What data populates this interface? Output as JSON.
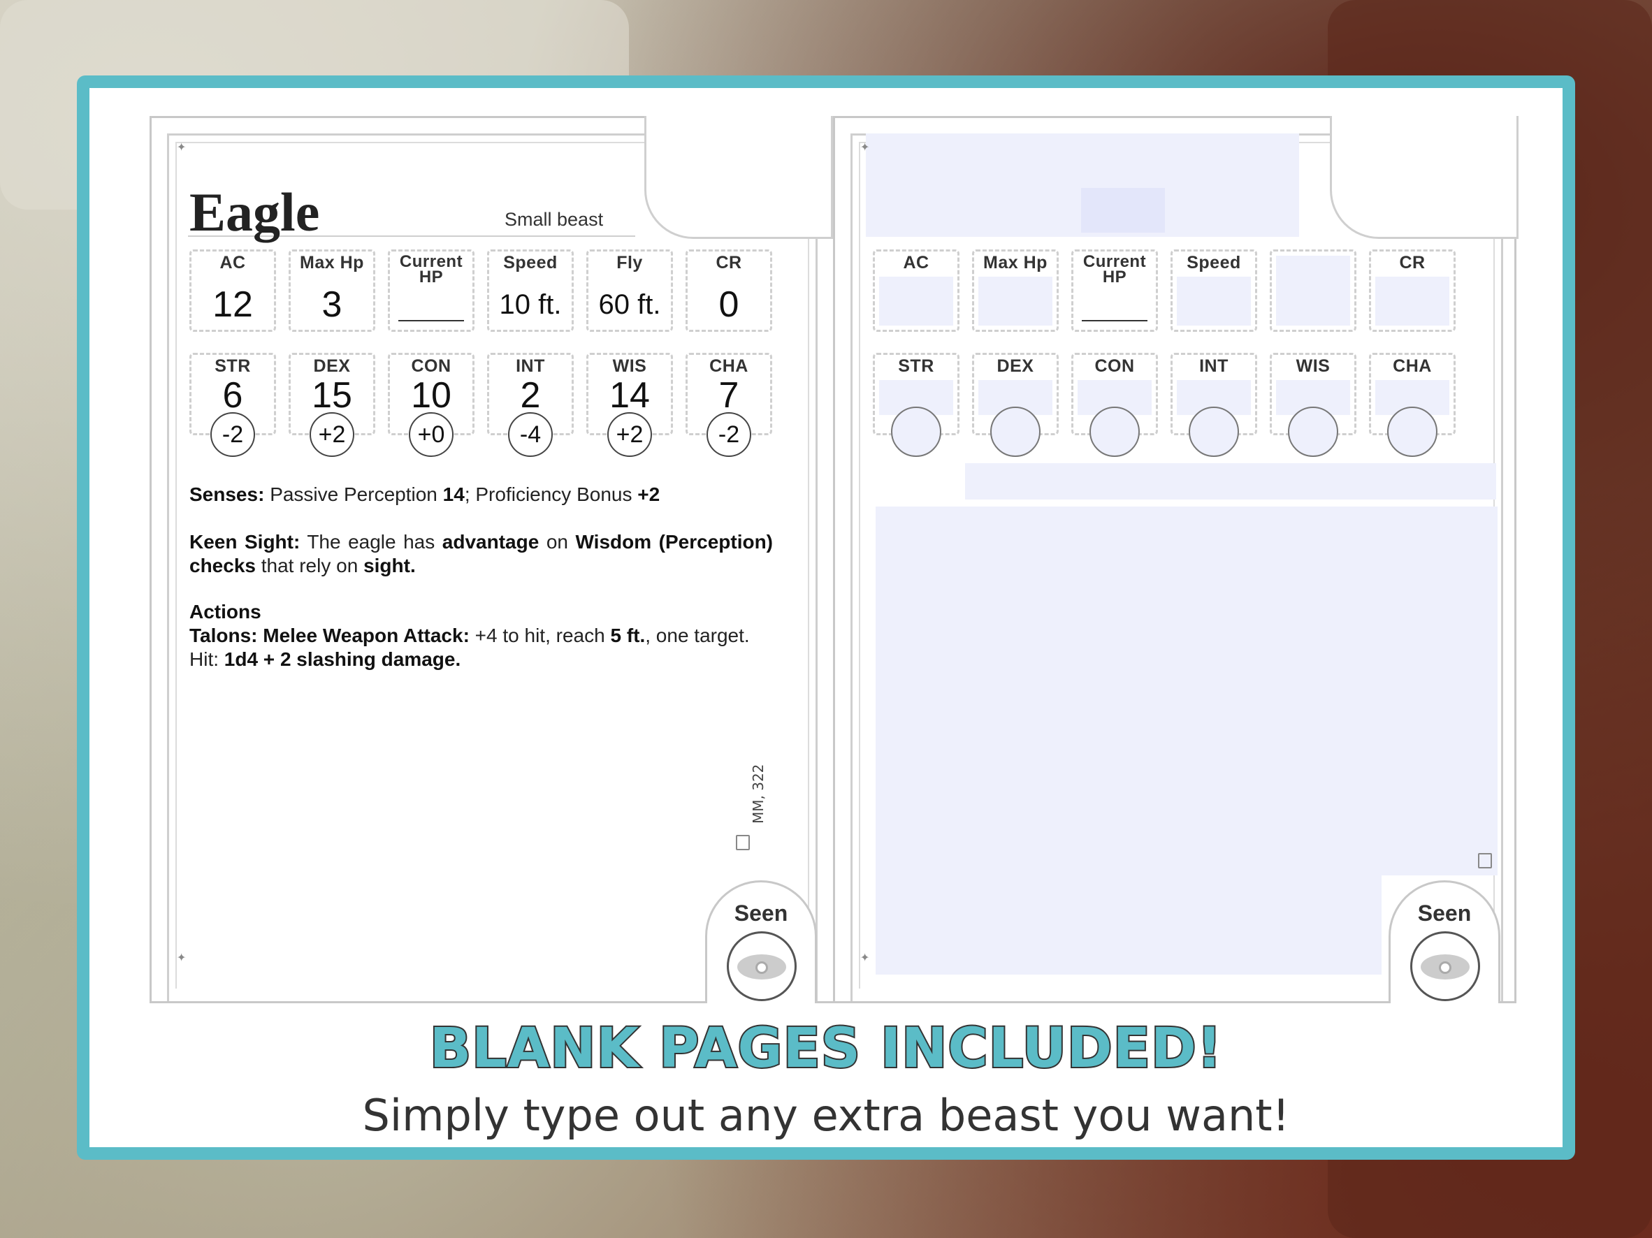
{
  "card": {
    "name": "Eagle",
    "type": "Small beast",
    "stats": [
      {
        "label": "AC",
        "value": "12"
      },
      {
        "label": "Max Hp",
        "value": "3"
      },
      {
        "label": "Current HP",
        "value": ""
      },
      {
        "label": "Speed",
        "value": "10 ft."
      },
      {
        "label": "Fly",
        "value": "60 ft."
      },
      {
        "label": "CR",
        "value": "0"
      }
    ],
    "abilities": [
      {
        "label": "STR",
        "score": "6",
        "mod": "-2"
      },
      {
        "label": "DEX",
        "score": "15",
        "mod": "+2"
      },
      {
        "label": "CON",
        "score": "10",
        "mod": "+0"
      },
      {
        "label": "INT",
        "score": "2",
        "mod": "-4"
      },
      {
        "label": "WIS",
        "score": "14",
        "mod": "+2"
      },
      {
        "label": "CHA",
        "score": "7",
        "mod": "-2"
      }
    ],
    "senses": {
      "label": "Senses:",
      "text_a": "Passive Perception",
      "value_a": "14",
      "text_b": "; Proficiency Bonus",
      "value_b": "+2"
    },
    "trait": {
      "name": "Keen Sight:",
      "t1": "The eagle has",
      "b1": "advantage",
      "t2": "on",
      "b2": "Wisdom (Perception) checks",
      "t3": "that rely on",
      "b3": "sight."
    },
    "actions": {
      "heading": "Actions",
      "name": "Talons: Melee Weapon Attack:",
      "t1": "+4 to hit, reach",
      "b1": "5 ft.",
      "t2": ", one target.",
      "t3": "Hit:",
      "b2": "1d4 + 2 slashing damage."
    },
    "source": "MM, 322",
    "seen_label": "Seen"
  },
  "blank_card": {
    "stats": [
      "AC",
      "Max Hp",
      "Current HP",
      "Speed",
      "",
      "CR"
    ],
    "abilities": [
      "STR",
      "DEX",
      "CON",
      "INT",
      "WIS",
      "CHA"
    ],
    "seen_label": "Seen"
  },
  "banner": {
    "headline": "BLANK PAGES INCLUDED!",
    "tagline": "Simply type out any extra beast you want!"
  },
  "colors": {
    "frame": "#5bbcc7",
    "field_fill": "#eef0fc"
  }
}
